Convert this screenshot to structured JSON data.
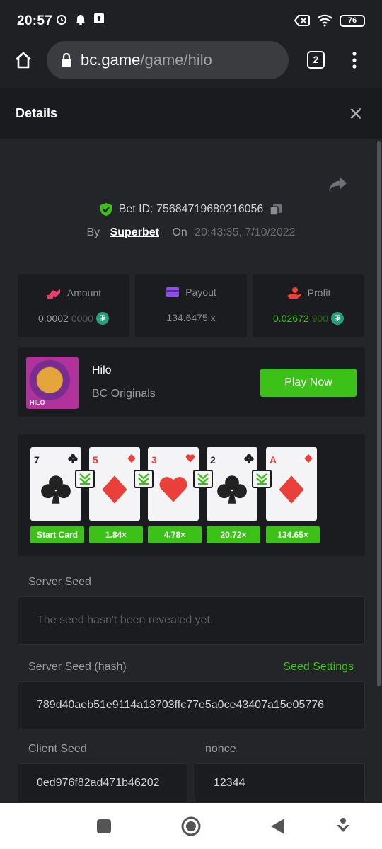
{
  "status": {
    "time": "20:57",
    "battery": "76"
  },
  "browser": {
    "url_host": "bc.game",
    "url_path": "/game/hilo",
    "tab_count": "2"
  },
  "details": {
    "title": "Details",
    "bet_id_label": "Bet ID: 75684719689216056",
    "by_label": "By",
    "user": "Superbet",
    "on_label": "On",
    "datetime": "20:43:35, 7/10/2022"
  },
  "stats": {
    "amount_label": "Amount",
    "amount_value": "0.0002",
    "amount_value_dim": "0000",
    "payout_label": "Payout",
    "payout_value": "134.6475 x",
    "profit_label": "Profit",
    "profit_value": "0.02672",
    "profit_value_dim": "900"
  },
  "game": {
    "thumb_tag": "HILO",
    "name": "Hilo",
    "provider": "BC Originals",
    "play_label": "Play Now"
  },
  "cards": [
    {
      "rank": "7",
      "suit": "clubs",
      "badge": "Start Card"
    },
    {
      "rank": "5",
      "suit": "diamonds",
      "badge": "1.84×"
    },
    {
      "rank": "3",
      "suit": "hearts",
      "badge": "4.78×"
    },
    {
      "rank": "2",
      "suit": "clubs",
      "badge": "20.72×"
    },
    {
      "rank": "A",
      "suit": "diamonds",
      "badge": "134.65×"
    }
  ],
  "seeds": {
    "server_seed_label": "Server Seed",
    "server_seed_value": "The seed hasn't been revealed yet.",
    "server_hash_label": "Server Seed (hash)",
    "seed_settings_label": "Seed Settings",
    "server_hash_value": "789d40aeb51e9114a13703ffc77e5a0ce43407a15e05776",
    "client_seed_label": "Client Seed",
    "client_seed_value": "0ed976f82ad471b46202",
    "nonce_label": "nonce",
    "nonce_value": "12344"
  },
  "colors": {
    "accent": "#3bc117",
    "bg": "#232529",
    "panel": "#1b1c1f",
    "red_suit": "#e9403a",
    "black_suit": "#222222"
  },
  "icons": [
    "home-icon",
    "lock-icon",
    "more-vert-icon",
    "close-icon",
    "share-icon",
    "shield-check-icon",
    "copy-icon",
    "amount-icon",
    "payout-icon",
    "profit-icon",
    "usdt-icon",
    "chevron-down-icon"
  ]
}
